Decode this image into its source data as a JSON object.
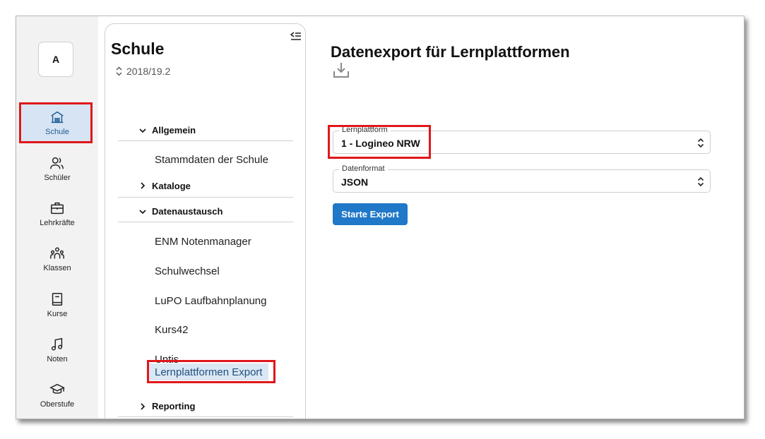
{
  "app": {
    "initial": "A"
  },
  "rail": {
    "items": [
      {
        "label": "Schule",
        "icon": "school-icon"
      },
      {
        "label": "Schüler",
        "icon": "students-icon"
      },
      {
        "label": "Lehrkräfte",
        "icon": "briefcase-icon"
      },
      {
        "label": "Klassen",
        "icon": "group-icon"
      },
      {
        "label": "Kurse",
        "icon": "book-icon"
      },
      {
        "label": "Noten",
        "icon": "music-note-icon"
      },
      {
        "label": "Oberstufe",
        "icon": "graduation-cap-icon"
      }
    ]
  },
  "panel": {
    "title": "Schule",
    "school_year": "2018/19.2",
    "groups": {
      "allgemein": "Allgemein",
      "kataloge": "Kataloge",
      "datenaustausch": "Datenaustausch",
      "reporting": "Reporting"
    },
    "items": {
      "stammdaten": "Stammdaten der Schule",
      "enm": "ENM Notenmanager",
      "schulwechsel": "Schulwechsel",
      "lupo": "LuPO Laufbahnplanung",
      "kurs42": "Kurs42",
      "untis": "Untis",
      "lernplattformen": "Lernplattformen Export"
    }
  },
  "main": {
    "title": "Datenexport für Lernplattformen",
    "lernplattform": {
      "label": "Lernplattform",
      "value": "1 - Logineo NRW"
    },
    "datenformat": {
      "label": "Datenformat",
      "value": "JSON"
    },
    "export_button": "Starte Export"
  },
  "colors": {
    "accent": "#1f78c8",
    "highlight": "#e0171a",
    "active_bg": "#d6e4f3"
  }
}
